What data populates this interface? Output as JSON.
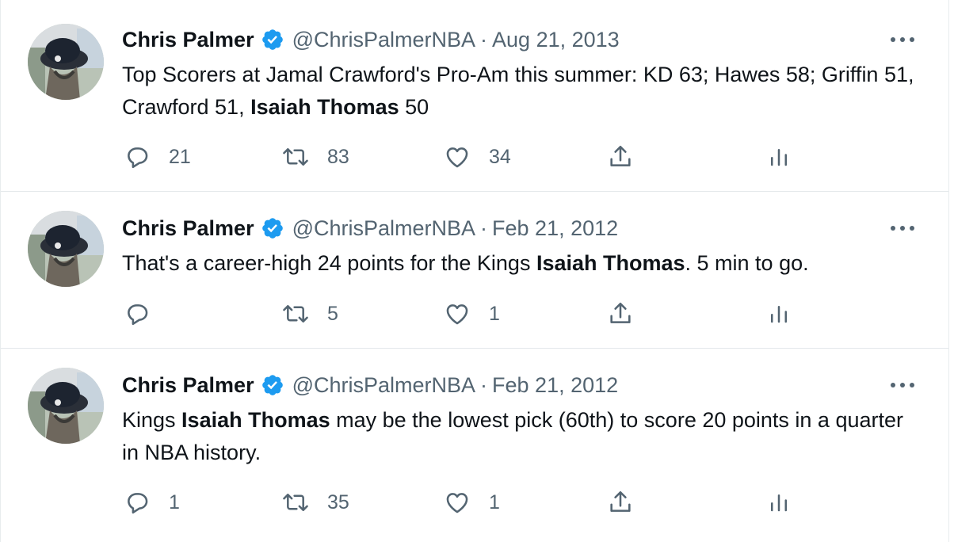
{
  "colors": {
    "text": "#0f1419",
    "secondary": "#536471",
    "verified": "#1d9bf0",
    "divider": "#e4e8eb"
  },
  "tweets": [
    {
      "name": "Chris Palmer",
      "handle": "@ChrisPalmerNBA",
      "separator": "·",
      "date": "Aug 21, 2013",
      "text": [
        "Top Scorers at Jamal Crawford's Pro-Am this summer: KD 63; Hawes 58; Griffin 51, Crawford 51, ",
        "Isaiah Thomas",
        " 50"
      ],
      "replies": "21",
      "retweets": "83",
      "likes": "34"
    },
    {
      "name": "Chris Palmer",
      "handle": "@ChrisPalmerNBA",
      "separator": "·",
      "date": "Feb 21, 2012",
      "text": [
        "That's a career-high 24 points for the Kings ",
        "Isaiah Thomas",
        ". 5 min to go."
      ],
      "replies": "",
      "retweets": "5",
      "likes": "1"
    },
    {
      "name": "Chris Palmer",
      "handle": "@ChrisPalmerNBA",
      "separator": "·",
      "date": "Feb 21, 2012",
      "text": [
        "Kings ",
        "Isaiah Thomas",
        " may be the lowest pick (60th) to score 20 points in a quarter in NBA history."
      ],
      "replies": "1",
      "retweets": "35",
      "likes": "1"
    }
  ],
  "icons": {
    "avatar": "avatar-photo",
    "verified": "verified-badge-icon",
    "more": "more-options-icon",
    "reply": "reply-icon",
    "retweet": "retweet-icon",
    "like": "heart-icon",
    "share": "share-icon",
    "stats": "analytics-icon"
  }
}
